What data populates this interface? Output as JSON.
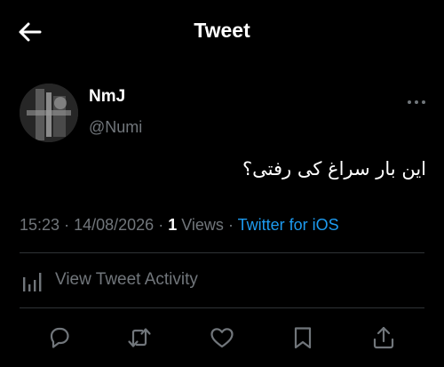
{
  "header": {
    "title": "Tweet",
    "back_icon": "arrow-left-icon"
  },
  "author": {
    "display_name": "NmJ",
    "handle": "@Numi"
  },
  "tweet": {
    "text": "این بار سراغ کی رفتی؟",
    "time": "15:23",
    "date": "14/08/2026",
    "separator": "·",
    "views_count": "1",
    "views_label": "Views",
    "source": "Twitter for iOS"
  },
  "activity": {
    "label": "View Tweet Activity",
    "icon": "bar-chart-icon"
  },
  "actions": {
    "reply_icon": "reply-icon",
    "retweet_icon": "retweet-icon",
    "like_icon": "heart-icon",
    "bookmark_icon": "bookmark-icon",
    "share_icon": "share-icon"
  },
  "colors": {
    "background": "#000000",
    "text_primary": "#ffffff",
    "text_secondary": "#71767b",
    "link": "#1d9bf0",
    "divider": "#2f3336"
  }
}
